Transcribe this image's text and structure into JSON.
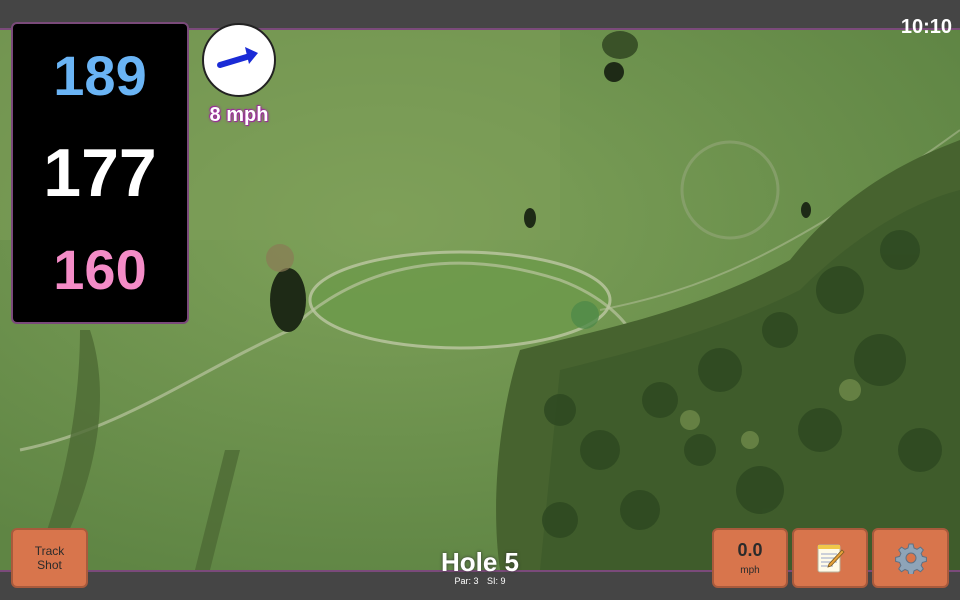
{
  "status": {
    "time": "10:10"
  },
  "distances": {
    "back": "189",
    "middle": "177",
    "front": "160"
  },
  "wind": {
    "speed": "8 mph",
    "icon": "wind-arrow-icon"
  },
  "buttons": {
    "track_line1": "Track",
    "track_line2": "Shot",
    "speed_value": "0.0",
    "speed_unit": "mph",
    "notes_icon": "notepad-icon",
    "settings_icon": "gear-icon"
  },
  "hole": {
    "title": "Hole 5",
    "par": "Par: 3",
    "si": "SI: 9"
  },
  "colors": {
    "back": "#6ab4f5",
    "middle": "#ffffff",
    "front": "#f48cc7",
    "button": "#d8754c",
    "accent": "#7a4a7a",
    "wind_arrow": "#1a2bd6"
  }
}
